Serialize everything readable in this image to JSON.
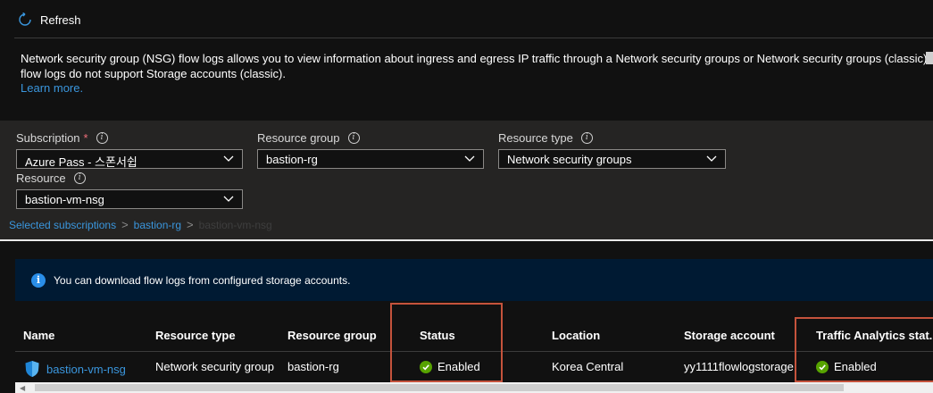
{
  "toolbar": {
    "refresh_label": "Refresh"
  },
  "description": {
    "line1": "Network security group (NSG) flow logs allows you to view information about ingress and egress IP traffic through a Network security groups or Network security groups (classic) .",
    "line2": "flow logs do not support Storage accounts (classic).",
    "learn_more": "Learn more."
  },
  "filters": {
    "subscription": {
      "label": "Subscription",
      "required_mark": "*",
      "value": "Azure Pass - 스폰서쉽"
    },
    "resource_group": {
      "label": "Resource group",
      "value": "bastion-rg"
    },
    "resource_type": {
      "label": "Resource type",
      "value": "Network security groups"
    },
    "resource": {
      "label": "Resource",
      "value": "bastion-vm-nsg"
    },
    "info_glyph": "i"
  },
  "breadcrumb": {
    "items": [
      "Selected subscriptions",
      "bastion-rg",
      "bastion-vm-nsg"
    ],
    "separator": ">"
  },
  "banner": {
    "icon": "info-icon",
    "icon_glyph": "i",
    "text": "You can download flow logs from configured storage accounts."
  },
  "table": {
    "columns": [
      "Name",
      "Resource type",
      "Resource group",
      "Status",
      "Location",
      "Storage account",
      "Traffic Analytics stat..."
    ],
    "rows": [
      {
        "name": "bastion-vm-nsg",
        "resource_type": "Network security group",
        "resource_group": "bastion-rg",
        "status": "Enabled",
        "location": "Korea Central",
        "storage_account": "yy1111flowlogstorage",
        "traffic_analytics": "Enabled"
      }
    ]
  },
  "colors": {
    "link": "#3a96dd",
    "enabled_green": "#57a300",
    "highlight": "#c5533c",
    "banner_bg": "#001a33",
    "filter_bg": "#252423"
  }
}
